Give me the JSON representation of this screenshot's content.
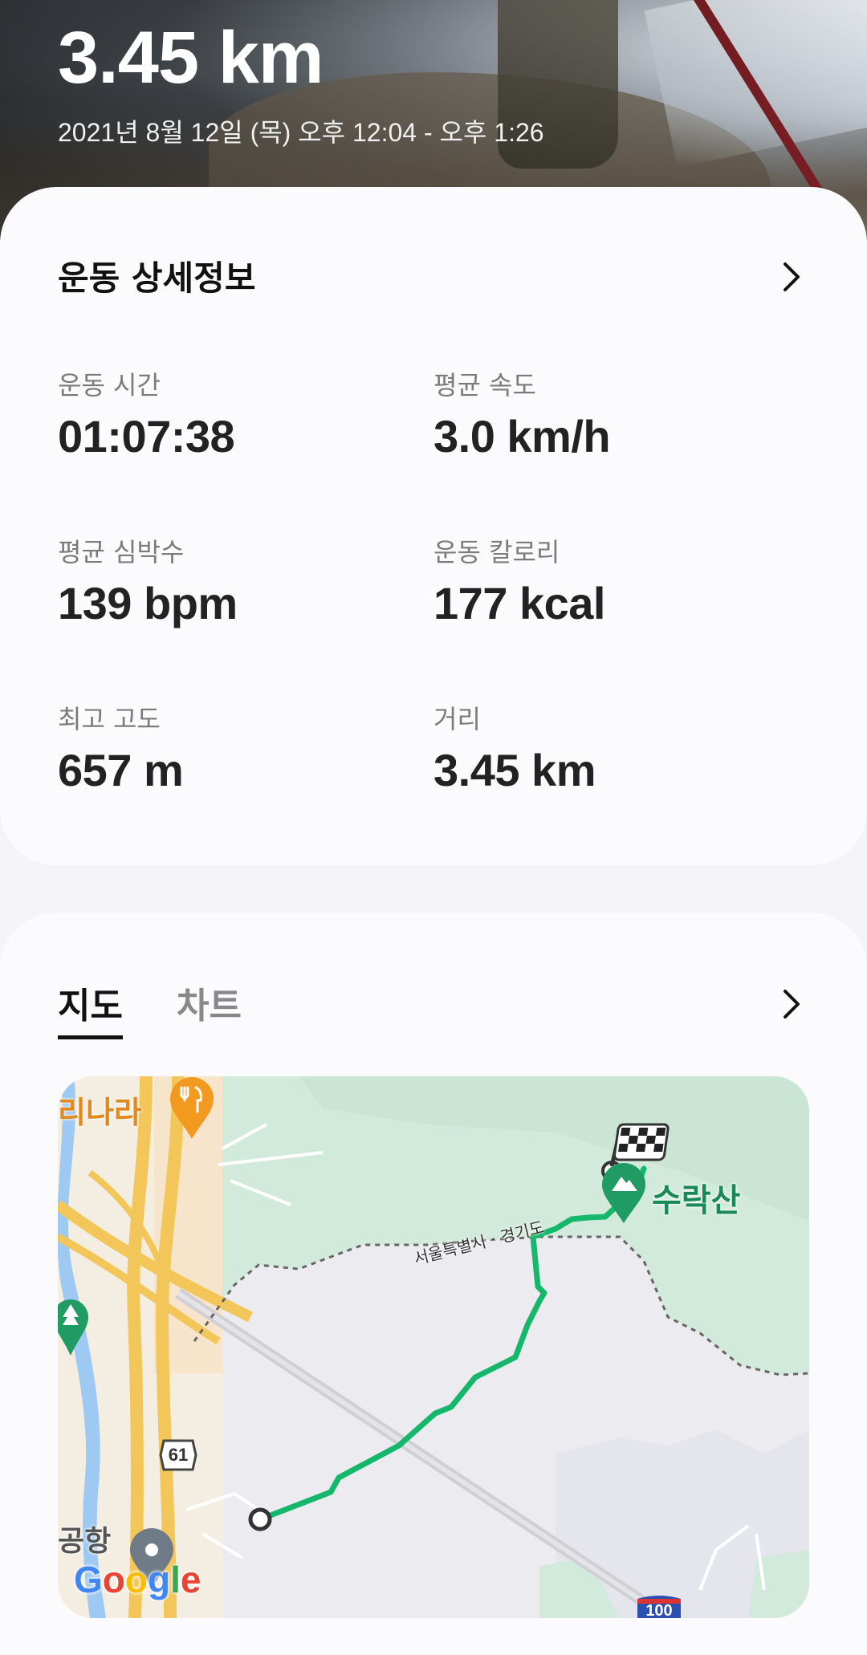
{
  "hero": {
    "distance": "3.45 km",
    "date_range": "2021년 8월 12일 (목) 오후 12:04 - 오후 1:26"
  },
  "details": {
    "title": "운동 상세정보",
    "metrics": [
      {
        "label": "운동 시간",
        "value": "01:07:38"
      },
      {
        "label": "평균 속도",
        "value": "3.0 km/h"
      },
      {
        "label": "평균 심박수",
        "value": "139 bpm"
      },
      {
        "label": "운동 칼로리",
        "value": "177 kcal"
      },
      {
        "label": "최고 고도",
        "value": "657 m"
      },
      {
        "label": "거리",
        "value": "3.45 km"
      }
    ]
  },
  "map_section": {
    "tabs": [
      {
        "label": "지도",
        "active": true
      },
      {
        "label": "차트",
        "active": false
      }
    ],
    "map": {
      "peak_label": "수락산",
      "restaurant_label": "리나라",
      "airport_label": "공항",
      "border_label": "서울특별시 · 경기도",
      "route_61": "61",
      "route_100": "100",
      "attribution": "Google",
      "colors": {
        "route": "#15b86a",
        "forest": "#cfe8d6",
        "land": "#ececf0",
        "road": "#f3c65a",
        "water": "#9ec9f2"
      }
    }
  },
  "icons": {
    "details_chevron": "chevron-right-icon",
    "map_chevron": "chevron-right-icon",
    "finish": "checkered-flag-icon",
    "start": "start-point-icon",
    "peak": "mountain-pin-icon",
    "restaurant": "restaurant-pin-icon",
    "location": "location-pin-icon",
    "park": "tree-pin-icon"
  }
}
